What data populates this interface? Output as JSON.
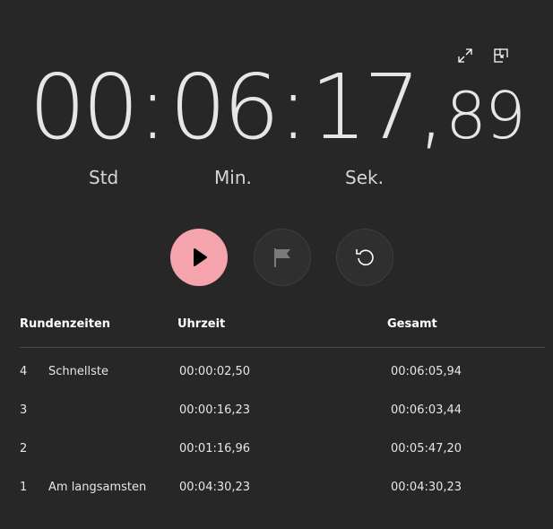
{
  "clock": {
    "hours": "00",
    "minutes": "06",
    "seconds": "17",
    "separator": ":",
    "decimal_separator": ",",
    "hundredths": "89"
  },
  "units": {
    "hours": "Std",
    "minutes": "Min.",
    "seconds": "Sek."
  },
  "icons": {
    "expand": "expand-icon",
    "compact_overlay": "compact-overlay-icon",
    "play": "play-icon",
    "flag": "flag-icon",
    "reset": "reset-icon"
  },
  "colors": {
    "play_accent": "#f5a3ac",
    "background": "#272727"
  },
  "laps": {
    "headers": {
      "laps": "Rundenzeiten",
      "time": "Uhrzeit",
      "total": "Gesamt"
    },
    "rows": [
      {
        "num": "4",
        "label": "Schnellste",
        "time": "00:00:02,50",
        "total": "00:06:05,94"
      },
      {
        "num": "3",
        "label": "",
        "time": "00:00:16,23",
        "total": "00:06:03,44"
      },
      {
        "num": "2",
        "label": "",
        "time": "00:01:16,96",
        "total": "00:05:47,20"
      },
      {
        "num": "1",
        "label": "Am langsamsten",
        "time": "00:04:30,23",
        "total": "00:04:30,23"
      }
    ]
  }
}
